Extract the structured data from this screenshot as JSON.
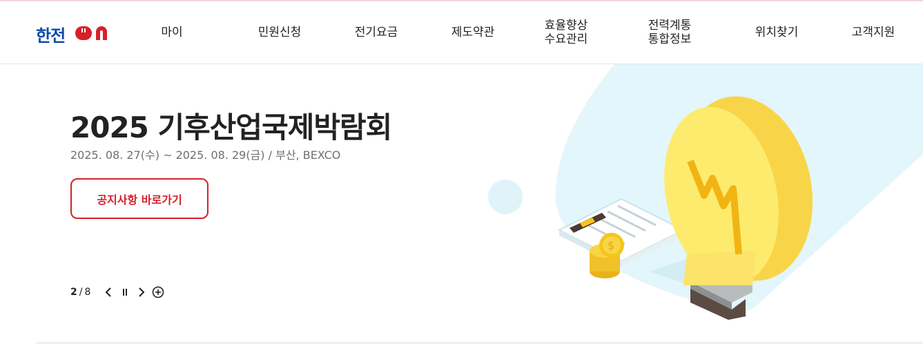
{
  "logo": {
    "text": "한전",
    "suffix": "ON"
  },
  "nav": [
    {
      "label": "마이",
      "lines": [
        "마이"
      ]
    },
    {
      "label": "민원신청",
      "lines": [
        "민원신청"
      ]
    },
    {
      "label": "전기요금",
      "lines": [
        "전기요금"
      ]
    },
    {
      "label": "제도약관",
      "lines": [
        "제도약관"
      ]
    },
    {
      "label": "효율향상 수요관리",
      "lines": [
        "효율향상",
        "수요관리"
      ]
    },
    {
      "label": "전력계통 통합정보",
      "lines": [
        "전력계통",
        "통합정보"
      ]
    },
    {
      "label": "위치찾기",
      "lines": [
        "위치찾기"
      ]
    },
    {
      "label": "고객지원",
      "lines": [
        "고객지원"
      ]
    }
  ],
  "hero": {
    "title": "2025 기후산업국제박람회",
    "subtitle": "2025. 08. 27(수) ~ 2025. 08. 29(금) / 부산, BEXCO",
    "cta_label": "공지사항 바로가기"
  },
  "pager": {
    "current": "2",
    "separator": "/",
    "total": "8",
    "icons": [
      "chevron-left-icon",
      "pause-icon",
      "chevron-right-icon",
      "plus-circle-icon"
    ]
  },
  "colors": {
    "brand_blue": "#0b4ba6",
    "brand_red": "#d7202a",
    "accent_bg": "#e3f6fb"
  }
}
